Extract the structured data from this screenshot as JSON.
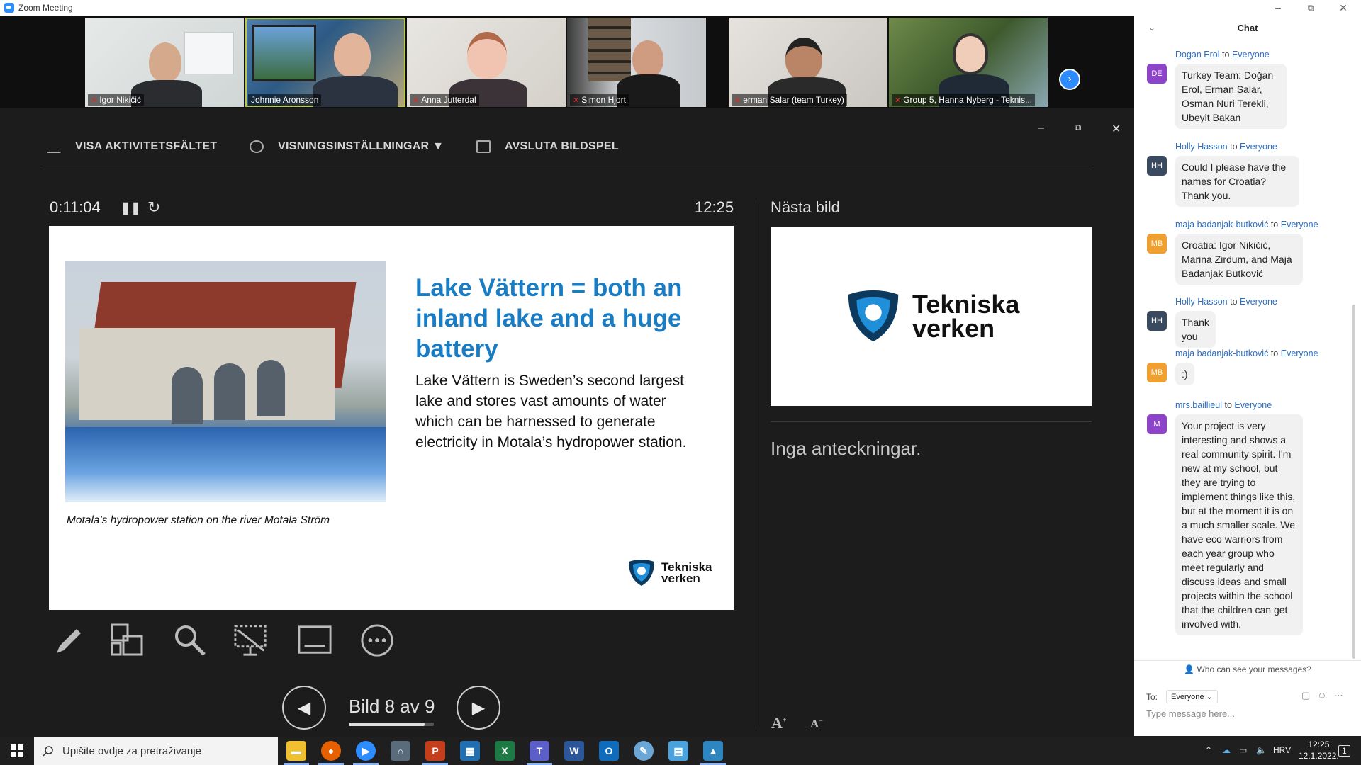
{
  "window": {
    "title": "Zoom Meeting",
    "minimize": "–",
    "restore": "⧉",
    "close": "✕"
  },
  "participants": [
    {
      "name": "Igor Nikičić",
      "muted": true,
      "active": false
    },
    {
      "name": "Johnnie Aronsson",
      "muted": false,
      "active": true
    },
    {
      "name": "Anna Jutterdal",
      "muted": true,
      "active": false
    },
    {
      "name": "Simon Hjort",
      "muted": true,
      "active": false
    },
    {
      "name": "erman Salar (team Turkey)",
      "muted": true,
      "active": false
    },
    {
      "name": "Group 5, Hanna Nyberg - Teknis...",
      "muted": true,
      "active": false
    }
  ],
  "presenter_toolbar": {
    "show_taskbar": "VISA AKTIVITETSFÄLTET",
    "display_settings": "VISNINGSINSTÄLLNINGAR ▼",
    "end_slideshow": "AVSLUTA BILDSPEL"
  },
  "presenter": {
    "timer": "0:11:04",
    "clock": "12:25",
    "next_slide_label": "Nästa bild",
    "notes": "Inga anteckningar.",
    "slide_counter": "Bild 8 av 9",
    "slide_progress": 0.89
  },
  "current_slide": {
    "title": "Lake Vättern = both an inland lake and a huge battery",
    "body": "Lake Vättern is Sweden’s second largest lake and stores vast amounts of water which can be harnessed to generate electricity in Motala’s hydropower station.",
    "caption": "Motala’s hydropower station on the river Motala Ström",
    "logo_line1": "Tekniska",
    "logo_line2": "verken"
  },
  "next_slide": {
    "logo_line1": "Tekniska",
    "logo_line2": "verken"
  },
  "chat": {
    "title": "Chat",
    "messages": [
      {
        "initials": "DE",
        "color": "#8e44c9",
        "sender": "Dogan Erol",
        "to": "to",
        "recipient": "Everyone",
        "text": "Turkey Team: Doğan Erol, Erman Salar, Osman Nuri Terekli, Ubeyit Bakan"
      },
      {
        "initials": "HH",
        "color": "#3a4a5e",
        "sender": "Holly Hasson",
        "to": "to",
        "recipient": "Everyone",
        "text": "Could I please have the names for Croatia? Thank you."
      },
      {
        "initials": "MB",
        "color": "#f0a030",
        "sender": "maja badanjak-butković",
        "to": "to",
        "recipient": "Everyone",
        "text": "Croatia: Igor Nikičić, Marina Zirdum, and Maja Badanjak Butković"
      },
      {
        "initials": "HH",
        "color": "#3a4a5e",
        "sender": "Holly Hasson",
        "to": "to",
        "recipient": "Everyone",
        "text": "Thank you"
      },
      {
        "initials": "MB",
        "color": "#f0a030",
        "sender": "maja badanjak-butković",
        "to": "to",
        "recipient": "Everyone",
        "text": ":)"
      },
      {
        "initials": "M",
        "color": "#8e44c9",
        "sender": "mrs.baillieul",
        "to": "to",
        "recipient": "Everyone",
        "text": "Your project is very interesting and shows a real community spirit. I'm new at my school, but they are trying to implement things like this, but at the moment it is on a much smaller scale. We have eco warriors from each year group who meet regularly and discuss ideas and small projects within the school that the children can get involved with."
      }
    ],
    "who_can_see": "Who can see your messages?",
    "to_label": "To:",
    "to_value": "Everyone",
    "input_placeholder": "Type message here..."
  },
  "taskbar": {
    "search_placeholder": "Upišite ovdje za pretraživanje",
    "language": "HRV",
    "time": "12:25",
    "date": "12.1.2022.",
    "notification_count": "1"
  }
}
